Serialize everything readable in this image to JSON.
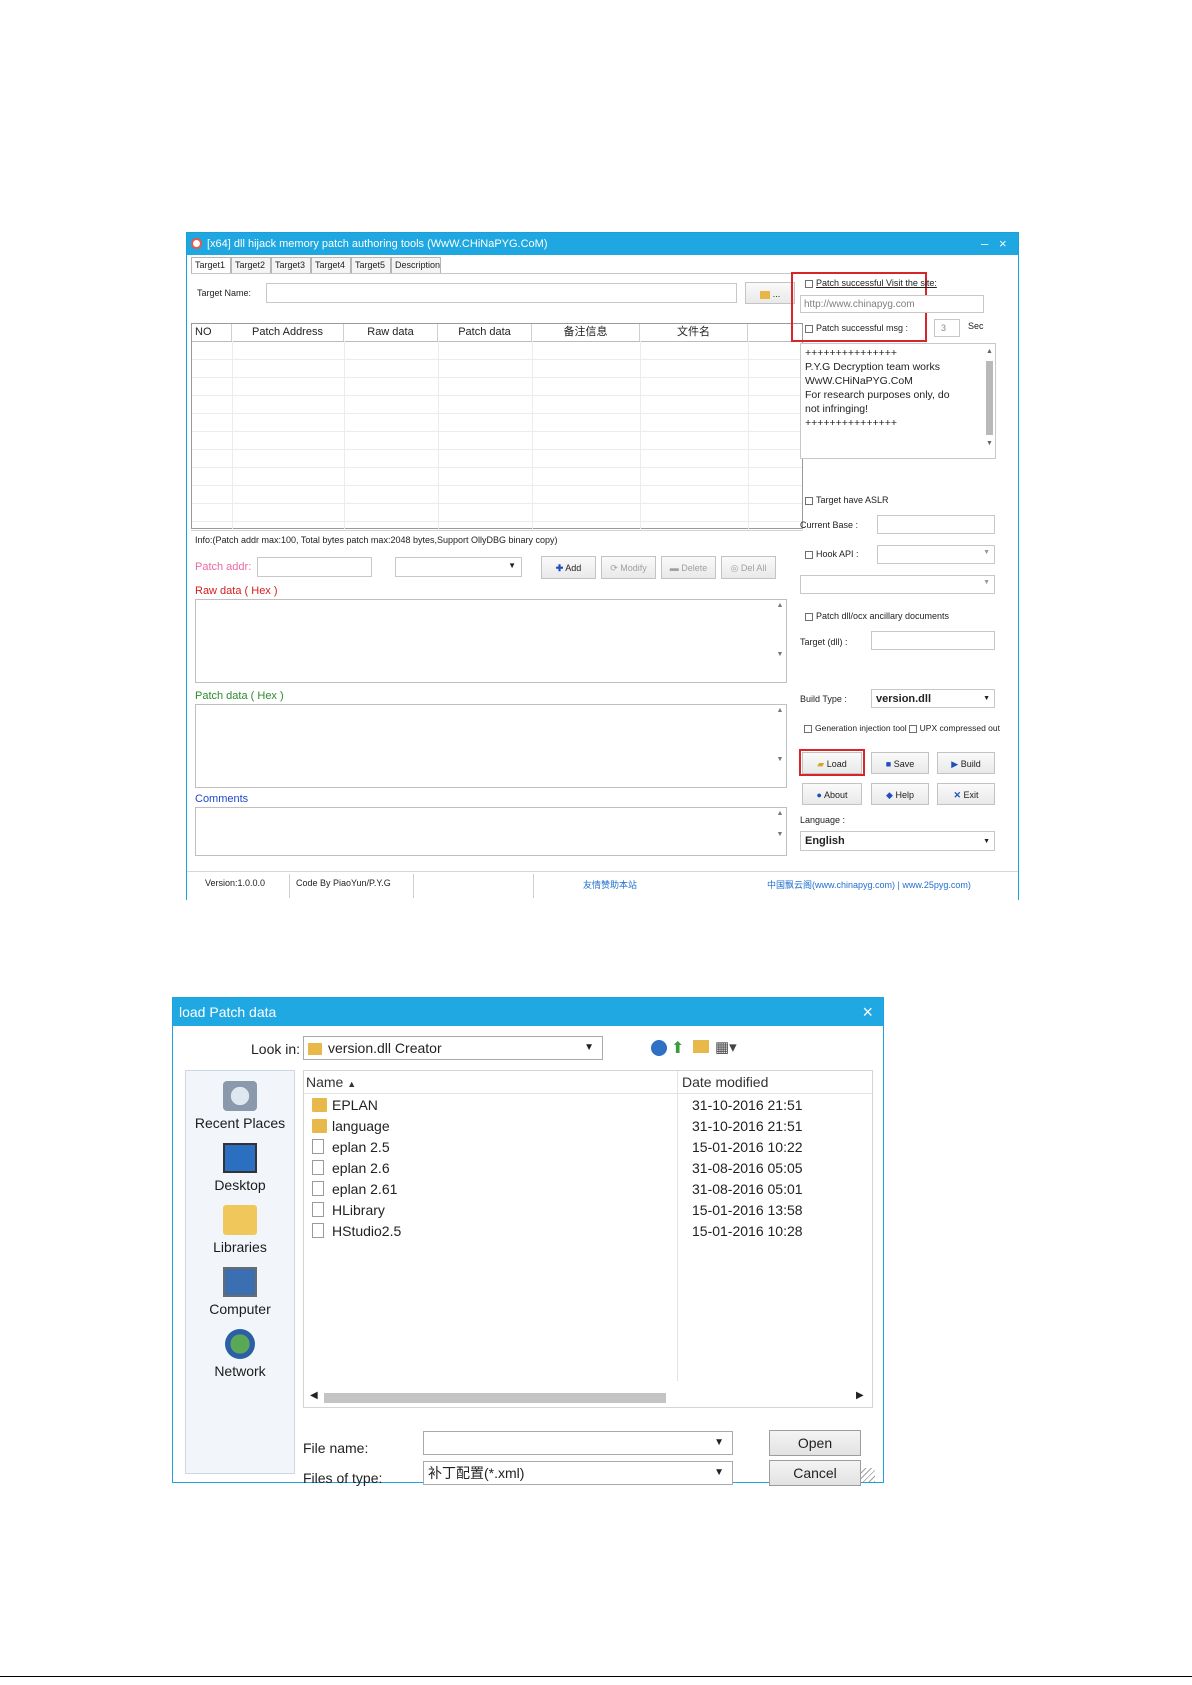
{
  "patch_tool": {
    "title": "[x64] dll hijack memory patch authoring tools (WwW.CHiNaPYG.CoM)",
    "controls": {
      "minimize": "–",
      "close": "×"
    },
    "tabs": [
      "Target1",
      "Target2",
      "Target3",
      "Target4",
      "Target5",
      "Description"
    ],
    "target_name_label": "Target Name:",
    "browse_button": "...",
    "table_headers": [
      "NO",
      "Patch Address",
      "Raw data",
      "Patch data",
      "备注信息",
      "文件名"
    ],
    "right_panel": {
      "visit_site_label": "Patch successful Visit the site:",
      "url_value": "http://www.chinapyg.com",
      "msg_label": "Patch successful msg :",
      "sec_value": "3",
      "sec_label": "Sec",
      "message_lines": [
        "+++++++++++++++",
        "P.Y.G Decryption team works",
        "WwW.CHiNaPYG.CoM",
        "For research purposes only, do",
        "not infringing!",
        "+++++++++++++++"
      ],
      "aslr_label": "Target have ASLR",
      "current_base_label": "Current Base :",
      "hook_api_label": "Hook API :",
      "ancillary_label": "Patch dll/ocx ancillary documents",
      "target_dll_label": "Target (dll) :",
      "build_type_label": "Build Type :",
      "build_type_value": "version.dll",
      "generation_injection_label": "Generation injection tool",
      "upx_label": "UPX compressed out",
      "buttons": {
        "load": "Load",
        "save": "Save",
        "build": "Build",
        "about": "About",
        "help": "Help",
        "exit": "Exit"
      },
      "language_label": "Language :",
      "language_value": "English"
    },
    "info_text": "Info:(Patch addr max:100, Total bytes patch max:2048 bytes,Support OllyDBG binary copy)",
    "patch_addr_label": "Patch addr:",
    "edit_buttons": {
      "add": "Add",
      "modify": "Modify",
      "delete": "Delete",
      "del_all": "Del All"
    },
    "raw_data_label": "Raw data ( Hex )",
    "patch_data_label": "Patch data ( Hex )",
    "comments_label": "Comments",
    "status_bar": {
      "version": "Version:1.0.0.0",
      "code_by": "Code By PiaoYun/P.Y.G",
      "link": "友情赞助本站",
      "sites": "中国飘云阁(www.chinapyg.com) | www.25pyg.com)"
    }
  },
  "open_dialog": {
    "title": "load Patch data",
    "close": "×",
    "look_in_label": "Look in:",
    "look_in_value": "version.dll Creator",
    "places": [
      "Recent Places",
      "Desktop",
      "Libraries",
      "Computer",
      "Network"
    ],
    "columns": {
      "name": "Name",
      "date": "Date modified"
    },
    "files": [
      {
        "name": "EPLAN",
        "date": "31-10-2016 21:51",
        "kind": "folder"
      },
      {
        "name": "language",
        "date": "31-10-2016 21:51",
        "kind": "folder"
      },
      {
        "name": "eplan 2.5",
        "date": "15-01-2016 10:22",
        "kind": "file"
      },
      {
        "name": "eplan 2.6",
        "date": "31-08-2016 05:05",
        "kind": "file"
      },
      {
        "name": "eplan 2.61",
        "date": "31-08-2016 05:01",
        "kind": "file"
      },
      {
        "name": "HLibrary",
        "date": "15-01-2016 13:58",
        "kind": "file"
      },
      {
        "name": "HStudio2.5",
        "date": "15-01-2016 10:28",
        "kind": "file"
      }
    ],
    "file_name_label": "File name:",
    "file_name_value": "",
    "files_of_type_label": "Files of type:",
    "files_of_type_value": "补丁配置(*.xml)",
    "open_button": "Open",
    "cancel_button": "Cancel"
  }
}
